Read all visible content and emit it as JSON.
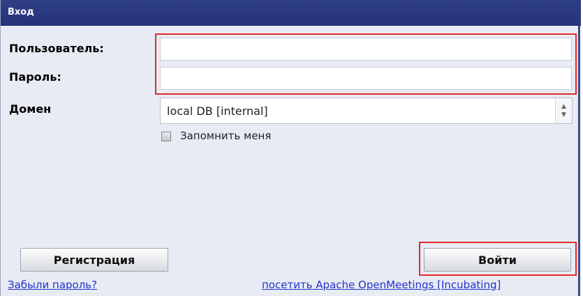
{
  "dialog": {
    "title": "Вход"
  },
  "form": {
    "user_label": "Пользователь:",
    "user_value": "",
    "password_label": "Пароль:",
    "password_value": "",
    "domain_label": "Домен",
    "domain_value": "local DB [internal]",
    "remember_label": "Запомнить меня",
    "remember_checked": false
  },
  "buttons": {
    "register_label": "Регистрация",
    "login_label": "Войти"
  },
  "links": {
    "forgot_password": "Забыли пароль?",
    "visit_site": "посетить Apache OpenMeetings [Incubating]"
  },
  "colors": {
    "titlebar": "#2f3f86",
    "highlight": "#e02b2b",
    "link": "#2233cc"
  },
  "icons": {
    "spinner": "up-down-arrows-icon"
  }
}
